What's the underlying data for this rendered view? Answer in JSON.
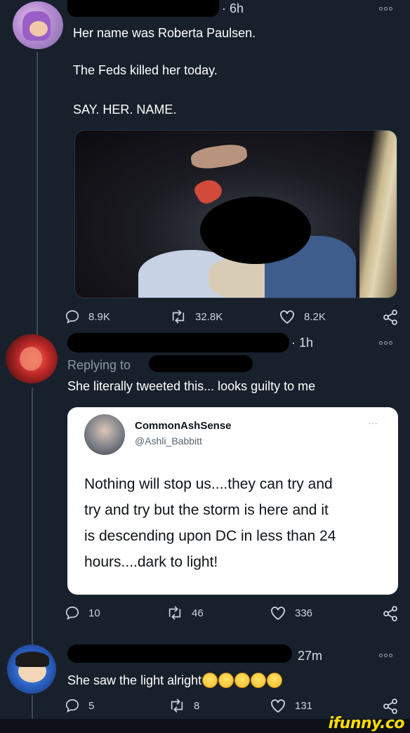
{
  "tweets": [
    {
      "time": "· 6h",
      "lines": [
        "Her name was Roberta Paulsen.",
        "The Feds killed her today.",
        "SAY. HER. NAME."
      ],
      "stats": {
        "replies": "8.9K",
        "retweets": "32.8K",
        "likes": "8.2K"
      }
    },
    {
      "time": "· 1h",
      "replying_to": "Replying to",
      "text": "She literally tweeted this... looks guilty to me",
      "quoted": {
        "display_name": "CommonAshSense",
        "handle": "@Ashli_Babbitt",
        "more": "···",
        "lines": [
          "Nothing will stop us....they can try and",
          "try and try but the storm is here and it",
          "is descending upon DC in less than 24",
          "hours....dark to light!"
        ]
      },
      "stats": {
        "replies": "10",
        "retweets": "46",
        "likes": "336"
      }
    },
    {
      "time": "27m",
      "text": "She saw the light alright",
      "stats": {
        "replies": "5",
        "retweets": "8",
        "likes": "131"
      }
    }
  ],
  "watermark": "ifunny.co",
  "colors": {
    "background": "#17202b",
    "text": "#ffffff",
    "muted": "#cdd6de",
    "watermark": "#ffdd00"
  },
  "icons": [
    "reply-icon",
    "retweet-icon",
    "like-icon",
    "share-icon",
    "more-icon"
  ]
}
